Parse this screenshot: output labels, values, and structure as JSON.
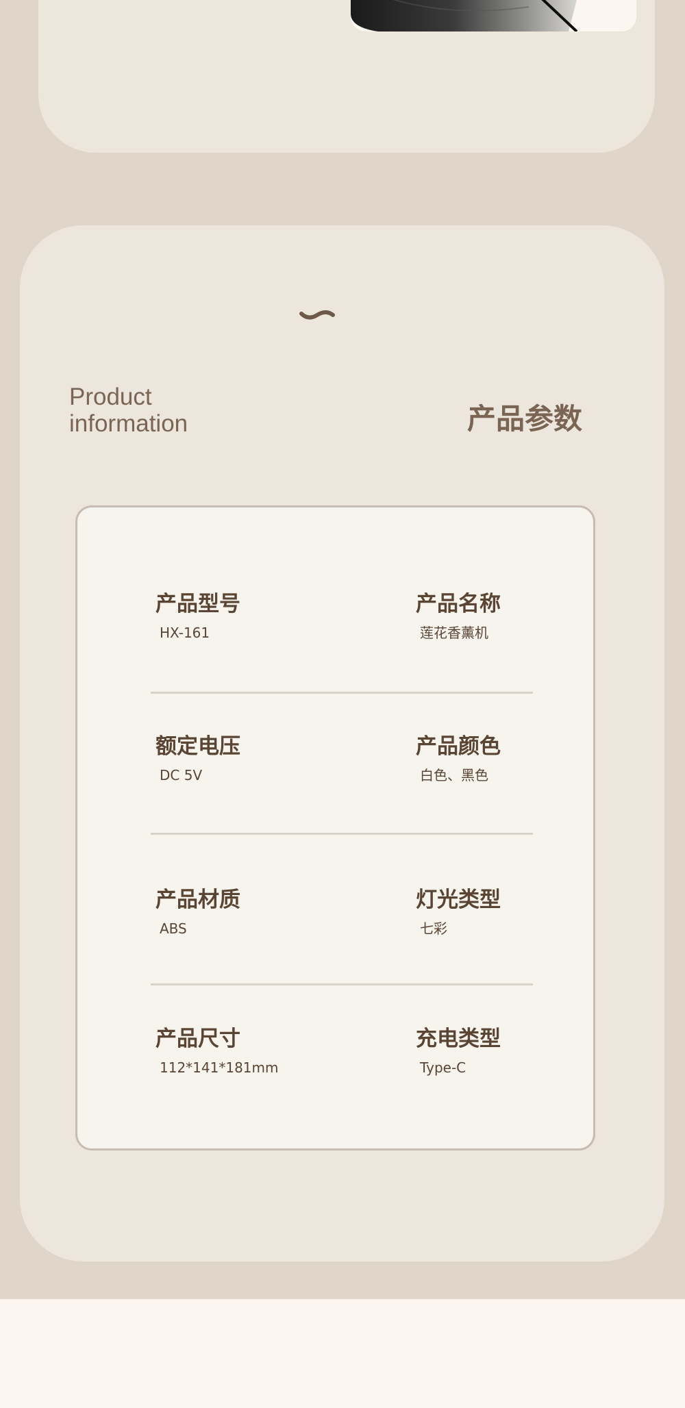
{
  "section": {
    "heading_en": "Product information",
    "heading_cn": "产品参数",
    "decor_icon": "tilde-icon"
  },
  "colors": {
    "page_background": "#e0d5c9",
    "card_background": "#ede6dc",
    "table_background": "#f7f4ee",
    "table_border": "#c7bcb1",
    "heading_text": "#7a6554",
    "body_text": "#5a4535",
    "footer_background": "#fdf5f0"
  },
  "specs": [
    {
      "label": "产品型号",
      "value": "HX-161"
    },
    {
      "label": "产品名称",
      "value": "莲花香薰机"
    },
    {
      "label": "额定电压",
      "value": "DC 5V"
    },
    {
      "label": "产品颜色",
      "value": "白色、黑色"
    },
    {
      "label": "产品材质",
      "value": "ABS"
    },
    {
      "label": "灯光类型",
      "value": "七彩"
    },
    {
      "label": "产品尺寸",
      "value": "112*141*181mm"
    },
    {
      "label": "充电类型",
      "value": "Type-C"
    }
  ]
}
